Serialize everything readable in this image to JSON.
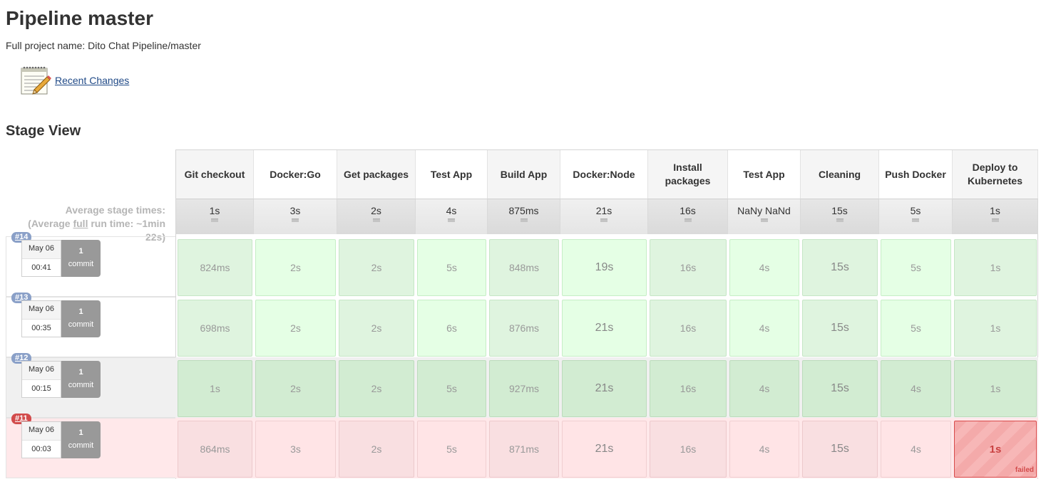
{
  "page": {
    "title": "Pipeline master",
    "full_name": "Full project name: Dito Chat Pipeline/master",
    "recent_changes": "Recent Changes",
    "stage_view_title": "Stage View"
  },
  "average": {
    "line1": "Average stage times:",
    "line2_prefix": "(Average ",
    "line2_underline": "full",
    "line2_suffix": " run time: ~1min",
    "line3": "22s)"
  },
  "stages": [
    {
      "name": "Git checkout",
      "avg": "1s"
    },
    {
      "name": "Docker:Go",
      "avg": "3s"
    },
    {
      "name": "Get packages",
      "avg": "2s"
    },
    {
      "name": "Test App",
      "avg": "4s"
    },
    {
      "name": "Build App",
      "avg": "875ms"
    },
    {
      "name": "Docker:Node",
      "avg": "21s"
    },
    {
      "name": "Install packages",
      "avg": "16s"
    },
    {
      "name": "Test App",
      "avg": "NaNy NaNd"
    },
    {
      "name": "Cleaning",
      "avg": "15s"
    },
    {
      "name": "Push Docker",
      "avg": "5s"
    },
    {
      "name": "Deploy to Kubernetes",
      "avg": "1s"
    }
  ],
  "runs": [
    {
      "id": "#14",
      "date": "May 06",
      "time": "00:41",
      "commit_count": "1",
      "commit_label": "commit",
      "status": "success",
      "cells": [
        "824ms",
        "2s",
        "2s",
        "5s",
        "848ms",
        "19s",
        "16s",
        "4s",
        "15s",
        "5s",
        "1s"
      ]
    },
    {
      "id": "#13",
      "date": "May 06",
      "time": "00:35",
      "commit_count": "1",
      "commit_label": "commit",
      "status": "success",
      "cells": [
        "698ms",
        "2s",
        "2s",
        "6s",
        "876ms",
        "21s",
        "16s",
        "4s",
        "15s",
        "5s",
        "1s"
      ]
    },
    {
      "id": "#12",
      "date": "May 06",
      "time": "00:15",
      "commit_count": "1",
      "commit_label": "commit",
      "status": "success",
      "cells": [
        "1s",
        "2s",
        "2s",
        "5s",
        "927ms",
        "21s",
        "16s",
        "4s",
        "15s",
        "4s",
        "1s"
      ]
    },
    {
      "id": "#11",
      "date": "May 06",
      "time": "00:03",
      "commit_count": "1",
      "commit_label": "commit",
      "status": "failed",
      "cells": [
        "864ms",
        "3s",
        "2s",
        "5s",
        "871ms",
        "21s",
        "16s",
        "4s",
        "15s",
        "4s",
        "1s"
      ],
      "failed_label": "failed"
    }
  ],
  "colors": {
    "success_light": "#e5ffe5",
    "success_dark": "#d2ecd2",
    "failed_light": "#ffe4e6",
    "failed_stage": "#f4aaaa",
    "failed_border": "#d84b4b",
    "link": "#204a87"
  },
  "icons": {
    "recent_changes": "notepad-icon"
  }
}
